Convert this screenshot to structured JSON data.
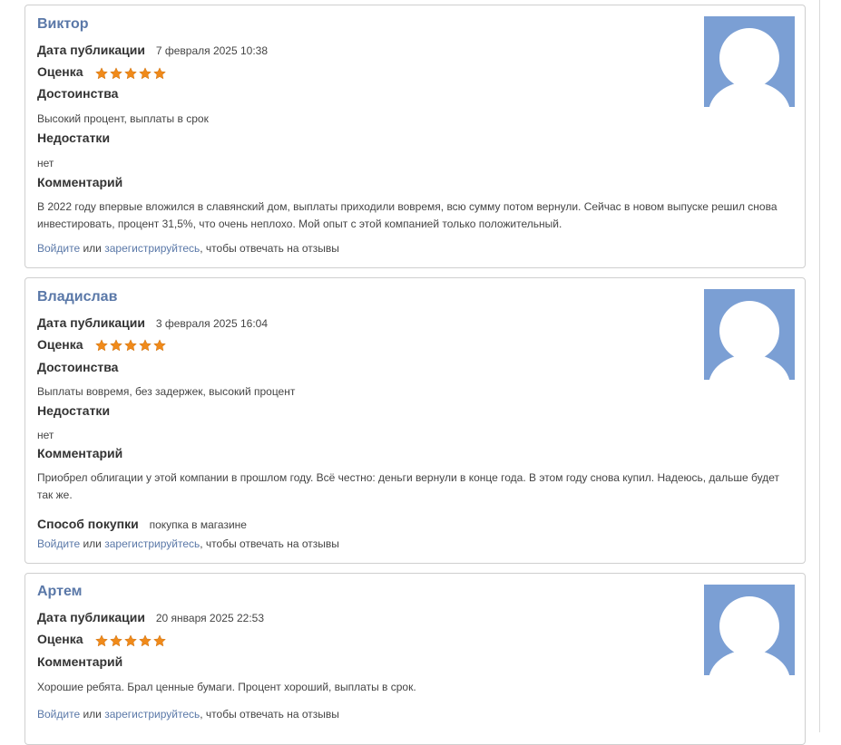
{
  "labels": {
    "date": "Дата публикации",
    "rating": "Оценка",
    "pros": "Достоинства",
    "cons": "Недостатки",
    "comment": "Комментарий",
    "purchase": "Способ покупки",
    "login": "Войдите",
    "or": "или",
    "register": "зарегистрируйтесь",
    "reply_suffix": ", чтобы отвечать на отзывы"
  },
  "colors": {
    "link": "#5a78a8",
    "star": "#f08a1a",
    "avatar": "#7b9fd4"
  },
  "icons": {
    "star": "star-icon",
    "avatar": "user-avatar-icon"
  },
  "reviews": [
    {
      "author": "Виктор",
      "date": "7 февраля 2025 10:38",
      "rating": 5,
      "pros": "Высокий процент, выплаты в срок",
      "cons": "нет",
      "comment": "В 2022 году впервые вложился в славянский дом, выплаты приходили вовремя, всю сумму потом вернули. Сейчас в новом выпуске решил снова инвестировать, процент 31,5%, что очень неплохо. Мой опыт с этой компанией только положительный."
    },
    {
      "author": "Владислав",
      "date": "3 февраля 2025 16:04",
      "rating": 5,
      "pros": "Выплаты вовремя, без задержек, высокий процент",
      "cons": "нет",
      "comment": "Приобрел облигации у этой компании в прошлом году. Всё честно: деньги вернули в конце года. В этом году снова купил. Надеюсь, дальше будет так же.",
      "purchase": "покупка в магазине"
    },
    {
      "author": "Артем",
      "date": "20 января 2025 22:53",
      "rating": 5,
      "comment": "Хорошие ребята. Брал ценные бумаги. Процент хороший, выплаты в срок."
    }
  ]
}
